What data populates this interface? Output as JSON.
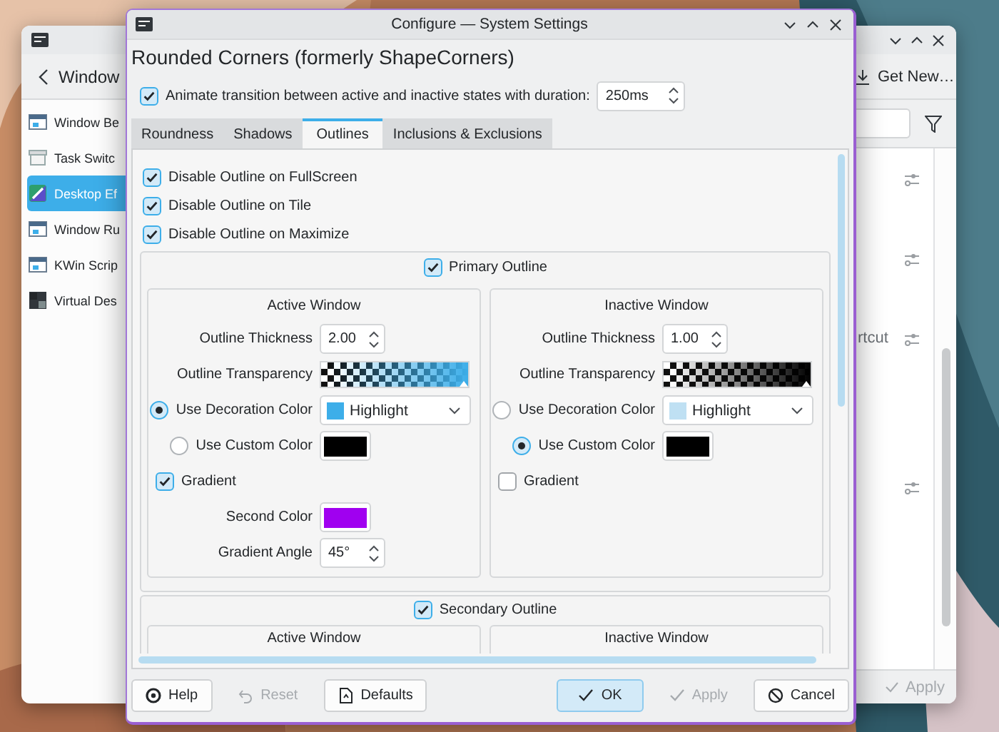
{
  "background_window": {
    "back_label": "Window",
    "sidebar": [
      {
        "label": "Window Be",
        "selected": false
      },
      {
        "label": "Task Switc",
        "selected": false
      },
      {
        "label": "Desktop Ef",
        "selected": true
      },
      {
        "label": "Window Ru",
        "selected": false
      },
      {
        "label": "KWin Scrip",
        "selected": false
      },
      {
        "label": "Virtual Des",
        "selected": false
      }
    ],
    "get_new": "Get New…",
    "list_text": "rtcut",
    "apply": {
      "label": "Apply",
      "disabled": true
    }
  },
  "dialog": {
    "title": "Configure — System Settings",
    "heading": "Rounded Corners (formerly ShapeCorners)",
    "animate": {
      "label": "Animate transition between active and inactive states with duration:",
      "checked": true,
      "value": "250ms"
    },
    "tabs": [
      {
        "label": "Roundness",
        "selected": false
      },
      {
        "label": "Shadows",
        "selected": false
      },
      {
        "label": "Outlines",
        "selected": true
      },
      {
        "label": "Inclusions & Exclusions",
        "selected": false
      }
    ],
    "options": [
      {
        "label": "Disable Outline on FullScreen",
        "checked": true
      },
      {
        "label": "Disable Outline on Tile",
        "checked": true
      },
      {
        "label": "Disable Outline on Maximize",
        "checked": true
      }
    ],
    "primary": {
      "label": "Primary Outline",
      "checked": true,
      "panels": [
        {
          "title": "Active Window",
          "thickness_label": "Outline Thickness",
          "thickness": "2.00",
          "transparency": {
            "label": "Outline Transparency",
            "level": 1
          },
          "decoration": {
            "label": "Use Decoration Color",
            "selected": true,
            "value": "Highlight",
            "color": "#3daee9"
          },
          "custom": {
            "label": "Use Custom Color",
            "selected": false,
            "color": "#000000"
          },
          "gradient": {
            "label": "Gradient",
            "checked": true
          },
          "second_color": {
            "label": "Second Color",
            "color": "#a000f0"
          },
          "angle": {
            "label": "Gradient Angle",
            "value": "45°"
          }
        },
        {
          "title": "Inactive Window",
          "thickness_label": "Outline Thickness",
          "thickness": "1.00",
          "transparency": {
            "label": "Outline Transparency",
            "level": 1
          },
          "decoration": {
            "label": "Use Decoration Color",
            "selected": false,
            "value": "Highlight",
            "color": "#bfe0f3"
          },
          "custom": {
            "label": "Use Custom Color",
            "selected": true,
            "color": "#000000"
          },
          "gradient": {
            "label": "Gradient",
            "checked": false
          }
        }
      ]
    },
    "secondary": {
      "label": "Secondary Outline",
      "checked": true,
      "panels": [
        {
          "title": "Active Window"
        },
        {
          "title": "Inactive Window"
        }
      ]
    },
    "buttons": [
      {
        "label": "Help",
        "disabled": false,
        "default": false
      },
      {
        "label": "Reset",
        "disabled": true,
        "default": false
      },
      {
        "label": "Defaults",
        "disabled": false,
        "default": false
      },
      {
        "label": "OK",
        "disabled": false,
        "default": true
      },
      {
        "label": "Apply",
        "disabled": true,
        "default": false
      },
      {
        "label": "Cancel",
        "disabled": false,
        "default": false
      }
    ]
  }
}
